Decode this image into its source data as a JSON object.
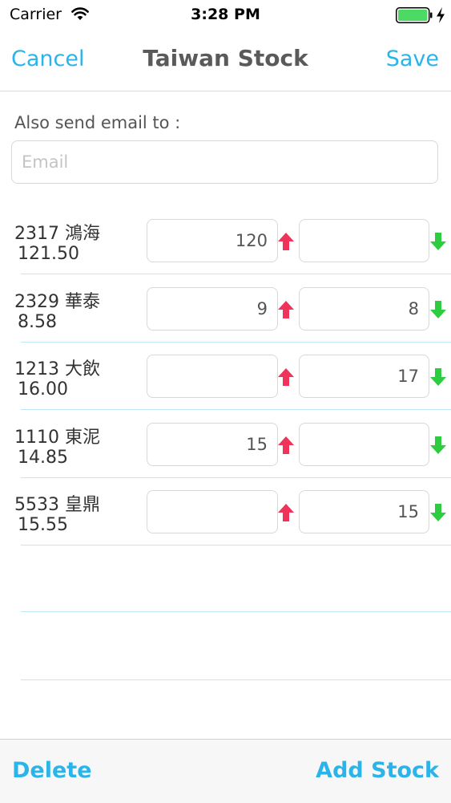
{
  "status_bar": {
    "carrier": "Carrier",
    "time": "3:28 PM",
    "wifi_icon": "wifi-icon",
    "battery_icon": "battery-full-icon",
    "charging_icon": "charging-bolt-icon",
    "battery_color": "#4cd964"
  },
  "nav": {
    "cancel_label": "Cancel",
    "title": "Taiwan Stock",
    "save_label": "Save"
  },
  "email": {
    "label": "Also send email to :",
    "placeholder": "Email",
    "value": ""
  },
  "stocks": [
    {
      "name": "2317 鴻海",
      "price": "121.50",
      "high": "120",
      "low": ""
    },
    {
      "name": "2329 華泰",
      "price": "8.58",
      "high": "9",
      "low": "8"
    },
    {
      "name": "1213 大飲",
      "price": "16.00",
      "high": "",
      "low": "17"
    },
    {
      "name": "1110 東泥",
      "price": "14.85",
      "high": "15",
      "low": ""
    },
    {
      "name": "5533 皇鼎",
      "price": "15.55",
      "high": "",
      "low": "15"
    }
  ],
  "icons": {
    "up": "up-arrow-icon",
    "down": "down-arrow-icon"
  },
  "colors": {
    "accent": "#2ab4ea",
    "up_arrow": "#f0335a",
    "down_arrow": "#2ecc40",
    "divider": "#bfe8f4"
  },
  "toolbar": {
    "delete_label": "Delete",
    "add_label": "Add Stock"
  }
}
